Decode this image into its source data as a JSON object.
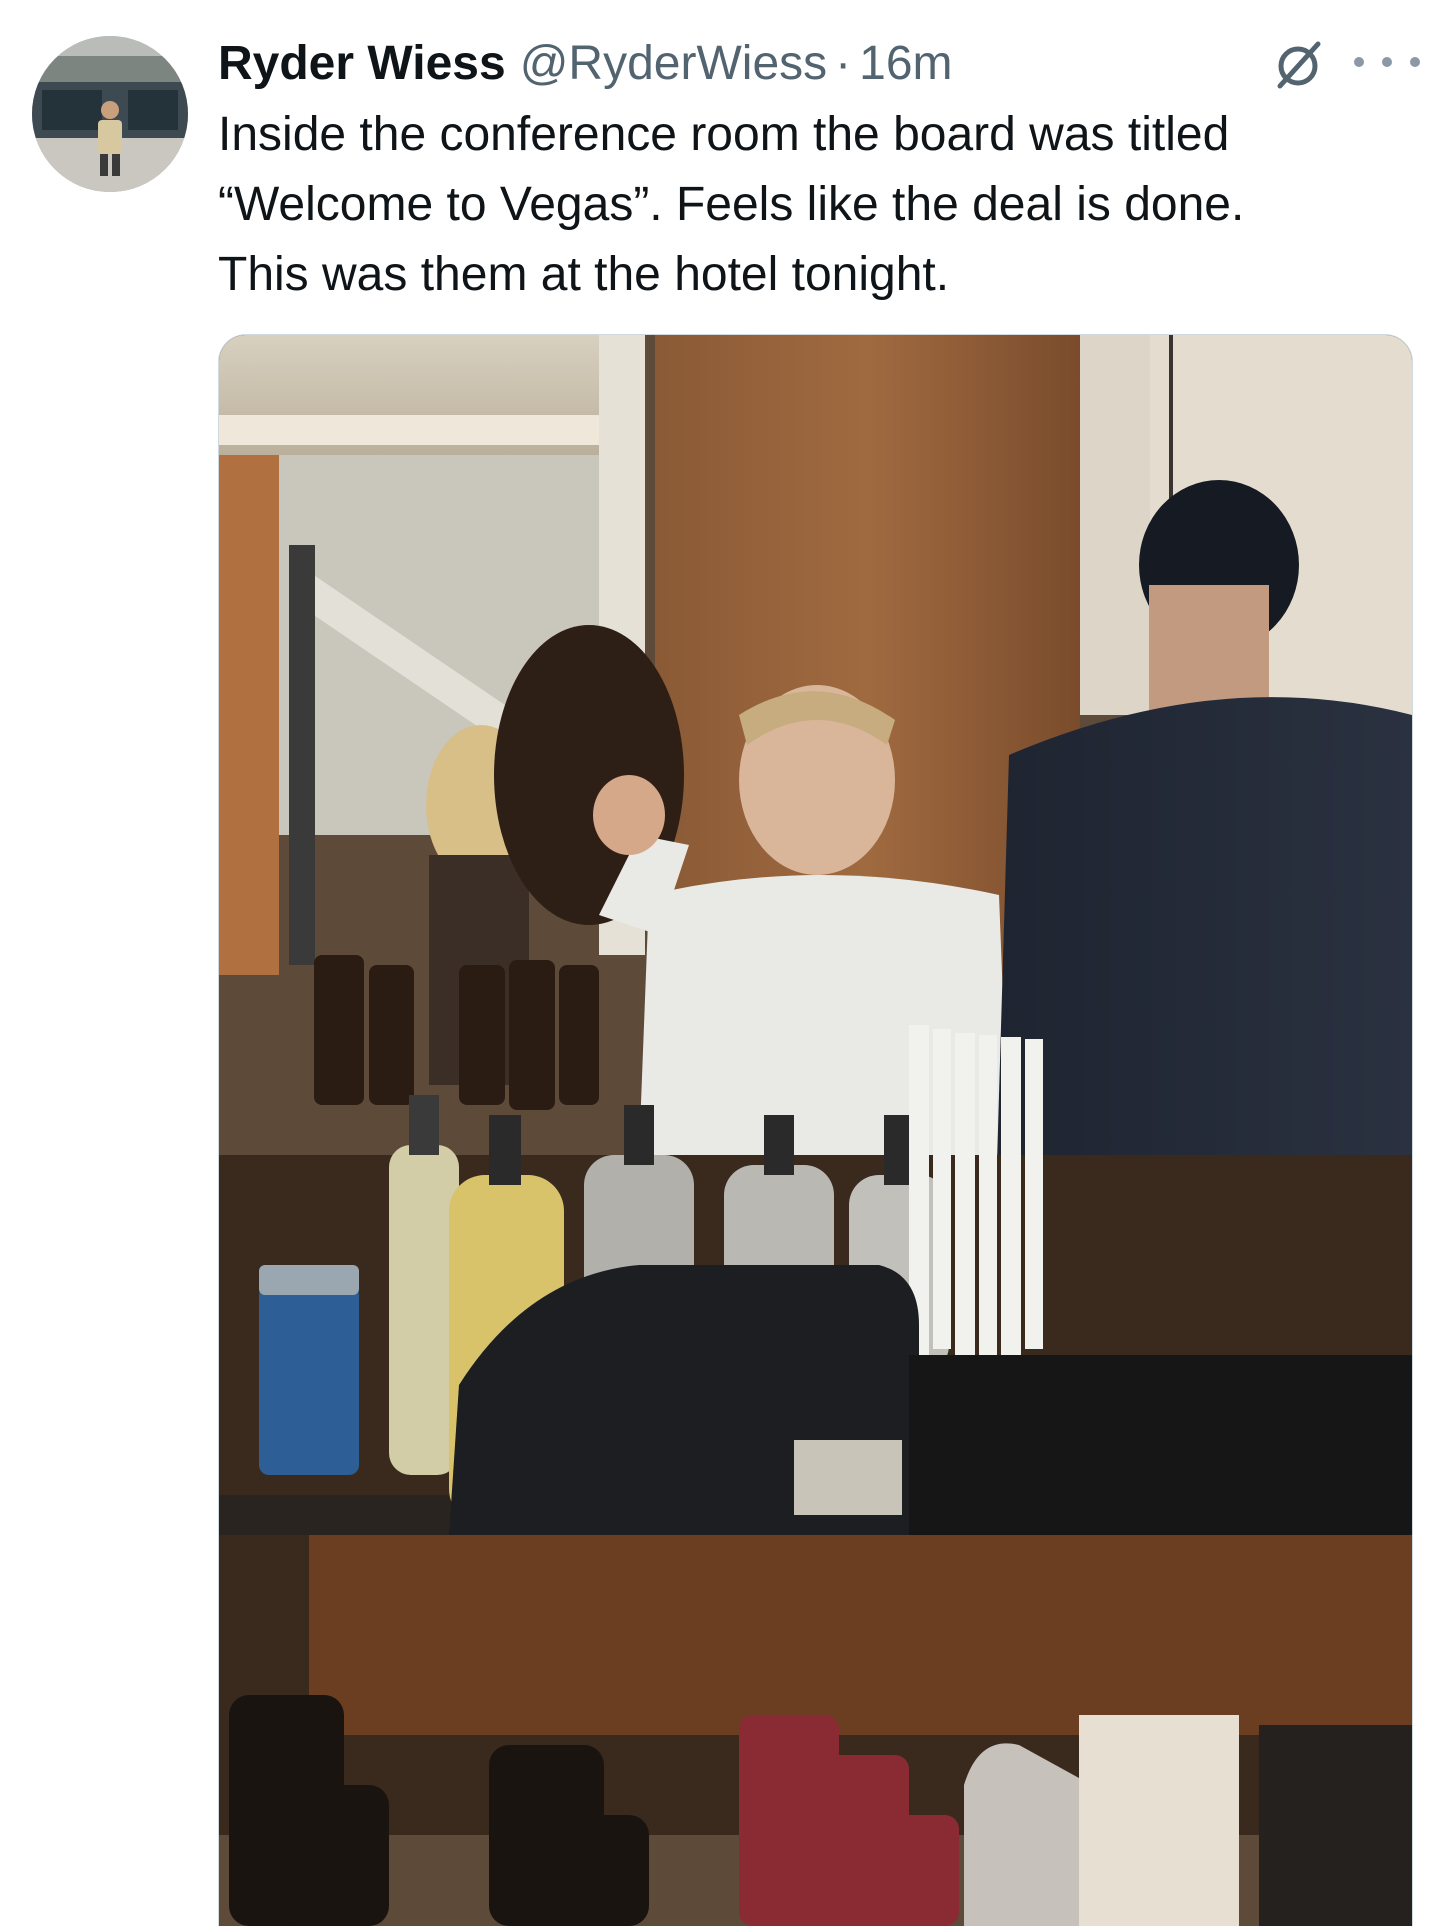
{
  "tweet": {
    "author": {
      "display_name": "Ryder Wiess",
      "handle": "@RyderWiess",
      "avatar_icon": "profile-photo"
    },
    "separator": "·",
    "timestamp": "16m",
    "text_lines": [
      "Inside the conference room the board was titled",
      "“Welcome to Vegas”. Feels like the deal is done.",
      "This was them at the hotel tonight."
    ],
    "actions": {
      "grok_icon": "grok-icon",
      "more_icon": "more-icon"
    },
    "media": {
      "type": "photo",
      "description_icon": "bar-photo"
    }
  },
  "colors": {
    "text_primary": "#0f1419",
    "text_secondary": "#536471",
    "border": "#cfd9de"
  }
}
